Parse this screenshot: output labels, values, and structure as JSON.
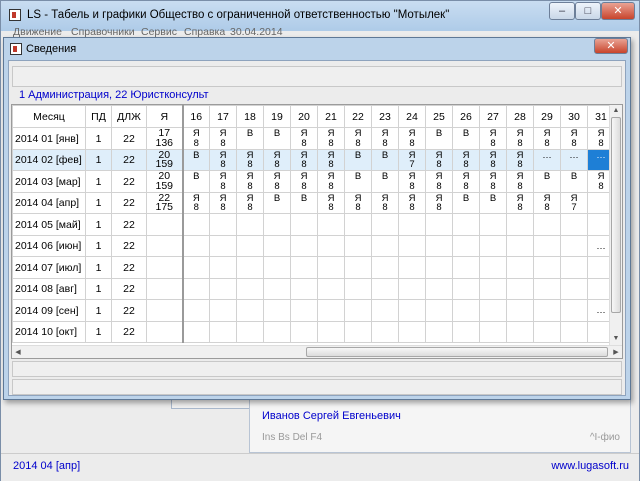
{
  "main_window": {
    "title": "LS - Табель и графики    Общество с ограниченной ответственностью \"Мотылек\"",
    "menu": [
      "Движение",
      "Справочники",
      "Сервис",
      "Справка",
      "30.04.2014"
    ],
    "status_left": "2014 04 [апр]",
    "status_right": "www.lugasoft.ru",
    "minimize_label": "–",
    "maximize_label": "□",
    "close_label": "✕"
  },
  "background_window": {
    "employee_name": "Иванов Сергей Евгеньевич",
    "hint_keys": "Ins Bs Del  F4",
    "hint_right": "^I-фио"
  },
  "dialog": {
    "title": "Сведения",
    "close_label": "✕",
    "info": "1  Администрация,  22  Юристконсульт",
    "columns": [
      "Месяц",
      "ПД",
      "ДЛЖ",
      "Я",
      "16",
      "17",
      "18",
      "19",
      "20",
      "21",
      "22",
      "23",
      "24",
      "25",
      "26",
      "27",
      "28",
      "29",
      "30",
      "31"
    ],
    "rows": [
      {
        "month": "2014 01 [янв]",
        "pd": "1",
        "dlzh": "22",
        "ya": [
          "17",
          "136"
        ],
        "days": [
          [
            "Я",
            "8"
          ],
          [
            "Я",
            "8"
          ],
          [
            "В",
            ""
          ],
          [
            "В",
            ""
          ],
          [
            "Я",
            "8"
          ],
          [
            "Я",
            "8"
          ],
          [
            "Я",
            "8"
          ],
          [
            "Я",
            "8"
          ],
          [
            "Я",
            "8"
          ],
          [
            "В",
            ""
          ],
          [
            "В",
            ""
          ],
          [
            "Я",
            "8"
          ],
          [
            "Я",
            "8"
          ],
          [
            "Я",
            "8"
          ],
          [
            "Я",
            "8"
          ],
          [
            "Я",
            "8"
          ]
        ]
      },
      {
        "month": "2014 02 [фев]",
        "pd": "1",
        "dlzh": "22",
        "ya": [
          "20",
          "159"
        ],
        "selected": true,
        "days": [
          [
            "В",
            ""
          ],
          [
            "Я",
            "8"
          ],
          [
            "Я",
            "8"
          ],
          [
            "Я",
            "8"
          ],
          [
            "Я",
            "8"
          ],
          [
            "Я",
            "8"
          ],
          [
            "В",
            ""
          ],
          [
            "В",
            ""
          ],
          [
            "Я",
            "7"
          ],
          [
            "Я",
            "8"
          ],
          [
            "Я",
            "8"
          ],
          [
            "Я",
            "8"
          ],
          [
            "Я",
            "8"
          ],
          [
            "…",
            ""
          ],
          [
            "…",
            ""
          ],
          [
            "…",
            ""
          ]
        ]
      },
      {
        "month": "2014 03 [мар]",
        "pd": "1",
        "dlzh": "22",
        "ya": [
          "20",
          "159"
        ],
        "days": [
          [
            "В",
            ""
          ],
          [
            "Я",
            "8"
          ],
          [
            "Я",
            "8"
          ],
          [
            "Я",
            "8"
          ],
          [
            "Я",
            "8"
          ],
          [
            "Я",
            "8"
          ],
          [
            "В",
            ""
          ],
          [
            "В",
            ""
          ],
          [
            "Я",
            "8"
          ],
          [
            "Я",
            "8"
          ],
          [
            "Я",
            "8"
          ],
          [
            "Я",
            "8"
          ],
          [
            "Я",
            "8"
          ],
          [
            "В",
            ""
          ],
          [
            "В",
            ""
          ],
          [
            "Я",
            "8"
          ]
        ]
      },
      {
        "month": "2014 04 [апр]",
        "pd": "1",
        "dlzh": "22",
        "ya": [
          "22",
          "175"
        ],
        "days": [
          [
            "Я",
            "8"
          ],
          [
            "Я",
            "8"
          ],
          [
            "Я",
            "8"
          ],
          [
            "В",
            ""
          ],
          [
            "В",
            ""
          ],
          [
            "Я",
            "8"
          ],
          [
            "Я",
            "8"
          ],
          [
            "Я",
            "8"
          ],
          [
            "Я",
            "8"
          ],
          [
            "Я",
            "8"
          ],
          [
            "В",
            ""
          ],
          [
            "В",
            ""
          ],
          [
            "Я",
            "8"
          ],
          [
            "Я",
            "8"
          ],
          [
            "Я",
            "7"
          ],
          [
            "",
            ""
          ]
        ]
      },
      {
        "month": "2014 05 [май]",
        "pd": "1",
        "dlzh": "22",
        "ya": [
          "",
          ""
        ],
        "days": []
      },
      {
        "month": "2014 06 [июн]",
        "pd": "1",
        "dlzh": "22",
        "ya": [
          "",
          ""
        ],
        "days": [],
        "last": "…"
      },
      {
        "month": "2014 07 [июл]",
        "pd": "1",
        "dlzh": "22",
        "ya": [
          "",
          ""
        ],
        "days": []
      },
      {
        "month": "2014 08 [авг]",
        "pd": "1",
        "dlzh": "22",
        "ya": [
          "",
          ""
        ],
        "days": []
      },
      {
        "month": "2014 09 [сен]",
        "pd": "1",
        "dlzh": "22",
        "ya": [
          "",
          ""
        ],
        "days": [],
        "last": "…"
      },
      {
        "month": "2014 10 [окт]",
        "pd": "1",
        "dlzh": "22",
        "ya": [
          "",
          ""
        ],
        "days": []
      }
    ]
  },
  "colors": {
    "link_blue": "#0000cc",
    "selection": "#1e7fd6",
    "title_bar": "#bcd3ea"
  }
}
